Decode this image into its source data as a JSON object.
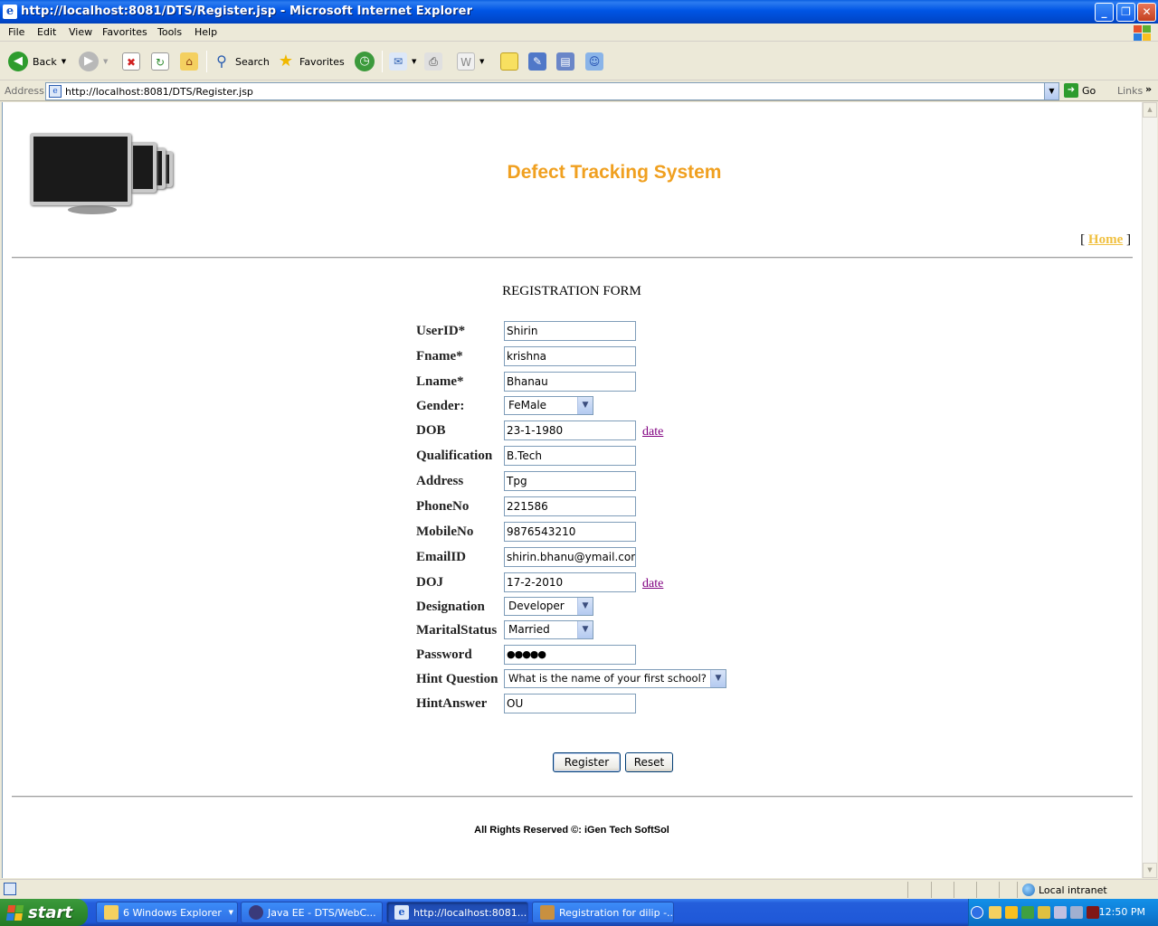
{
  "window": {
    "title": "http://localhost:8081/DTS/Register.jsp - Microsoft Internet Explorer"
  },
  "menu": [
    "File",
    "Edit",
    "View",
    "Favorites",
    "Tools",
    "Help"
  ],
  "toolbar": {
    "back": "Back",
    "search": "Search",
    "favorites": "Favorites"
  },
  "address": {
    "label": "Address",
    "url": "http://localhost:8081/DTS/Register.jsp",
    "go": "Go",
    "links": "Links"
  },
  "page": {
    "site_title": "Defect Tracking System",
    "home_open": "[",
    "home_link": "Home",
    "home_close": "]",
    "form_title": "REGISTRATION FORM",
    "date_link": "date",
    "fields": {
      "userid": {
        "label": "UserID*",
        "value": "Shirin"
      },
      "fname": {
        "label": "Fname*",
        "value": "krishna"
      },
      "lname": {
        "label": "Lname*",
        "value": "Bhanau"
      },
      "gender": {
        "label": "Gender:",
        "value": "FeMale"
      },
      "dob": {
        "label": "DOB",
        "value": "23-1-1980"
      },
      "qualification": {
        "label": "Qualification",
        "value": "B.Tech"
      },
      "address": {
        "label": "Address",
        "value": "Tpg"
      },
      "phoneno": {
        "label": "PhoneNo",
        "value": "221586"
      },
      "mobileno": {
        "label": "MobileNo",
        "value": "9876543210"
      },
      "emailid": {
        "label": "EmailID",
        "value": "shirin.bhanu@ymail.com"
      },
      "doj": {
        "label": "DOJ",
        "value": "17-2-2010"
      },
      "designation": {
        "label": "Designation",
        "value": "Developer"
      },
      "maritalstatus": {
        "label": "MaritalStatus",
        "value": "Married"
      },
      "password": {
        "label": "Password",
        "value": "●●●●●"
      },
      "hintquestion": {
        "label": "Hint Question",
        "value": "What is the name of your first school?"
      },
      "hintanswer": {
        "label": "HintAnswer",
        "value": "OU"
      }
    },
    "register_button": "Register",
    "reset_button": "Reset",
    "copyright": "All Rights Reserved ©: iGen Tech SoftSol"
  },
  "status": {
    "zone": "Local intranet"
  },
  "taskbar": {
    "start": "start",
    "tasks": [
      "6 Windows Explorer",
      "Java EE - DTS/WebC...",
      "http://localhost:8081...",
      "Registration for dilip -..."
    ],
    "clock": "12:50 PM"
  },
  "colors": {
    "site_title": "#F0A020",
    "home_link": "#F0C040",
    "date_link": "#800080",
    "xp_blue": "#0055E5"
  }
}
